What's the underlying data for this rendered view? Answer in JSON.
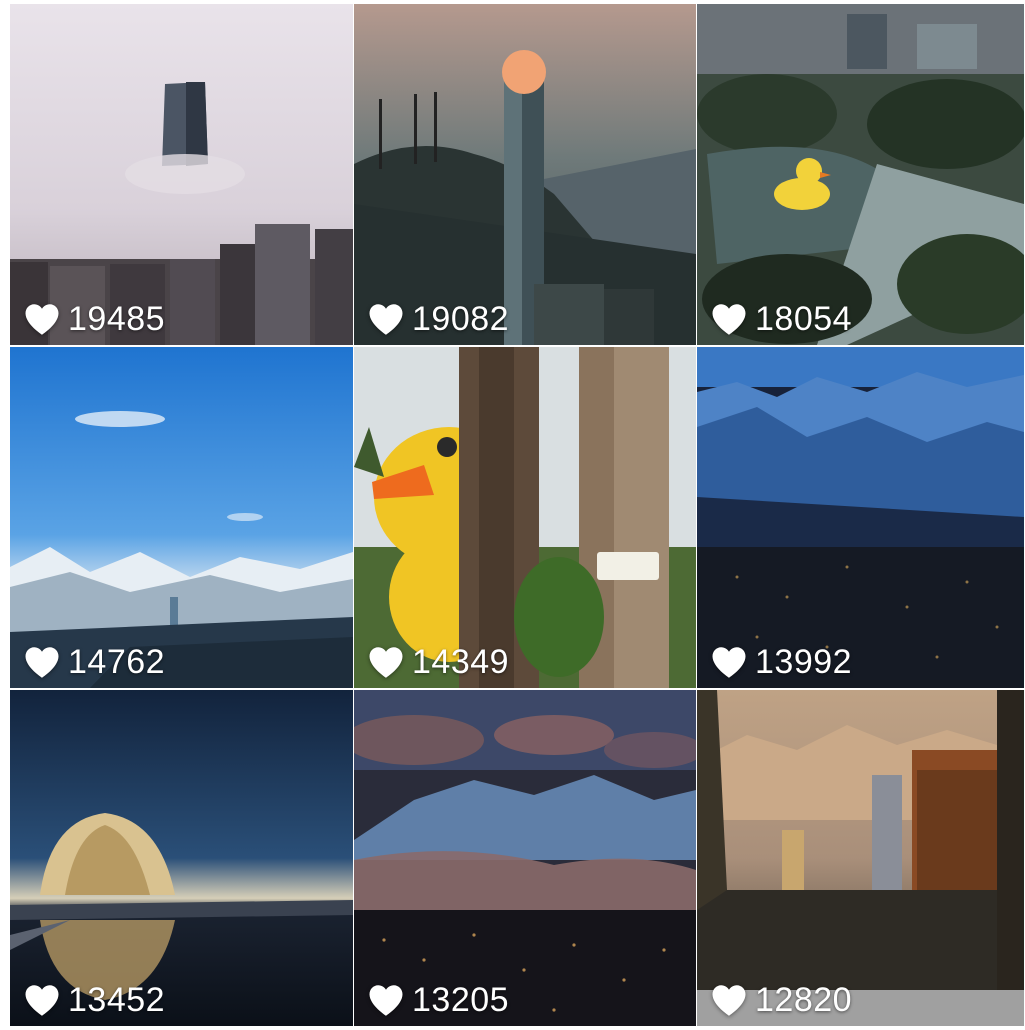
{
  "icons": {
    "like": "heart-icon"
  },
  "colors": {
    "like_icon": "#ffffff",
    "count_text": "#ffffff"
  },
  "tiles": [
    {
      "likes": "19485"
    },
    {
      "likes": "19082"
    },
    {
      "likes": "18054"
    },
    {
      "likes": "14762"
    },
    {
      "likes": "14349"
    },
    {
      "likes": "13992"
    },
    {
      "likes": "13452"
    },
    {
      "likes": "13205"
    },
    {
      "likes": "12820"
    }
  ]
}
